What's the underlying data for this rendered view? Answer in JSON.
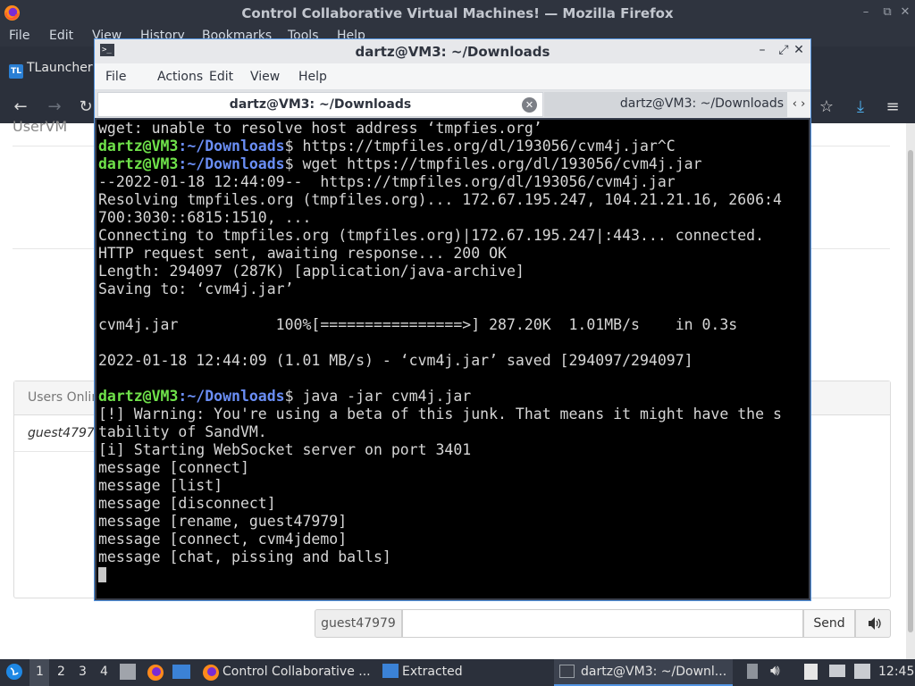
{
  "firefox": {
    "window_title": "Control Collaborative Virtual Machines! — Mozilla Firefox",
    "menu": [
      "File",
      "Edit",
      "View",
      "History",
      "Bookmarks",
      "Tools",
      "Help"
    ],
    "bookmark": "TLauncher",
    "bookmark_icon": "TL",
    "page": {
      "heading": "UserVM",
      "users_header": "Users Online",
      "users": [
        "guest47979"
      ],
      "chat_username": "guest47979",
      "send_label": "Send"
    }
  },
  "terminal": {
    "title": "dartz@VM3: ~/Downloads",
    "menu": [
      "File",
      "Actions",
      "Edit",
      "View",
      "Help"
    ],
    "tabs": [
      "dartz@VM3: ~/Downloads",
      "dartz@VM3: ~/Downloads"
    ],
    "prompt": {
      "user": "dartz@VM3",
      "path": ":~/Downloads",
      "symbol": "$"
    },
    "lines": [
      {
        "text": "wget: unable to resolve host address ‘tmpfies.org’"
      },
      {
        "prompt": true,
        "text": " https://tmpfiles.org/dl/193056/cvm4j.jar^C"
      },
      {
        "prompt": true,
        "text": " wget https://tmpfiles.org/dl/193056/cvm4j.jar"
      },
      {
        "text": "--2022-01-18 12:44:09--  https://tmpfiles.org/dl/193056/cvm4j.jar"
      },
      {
        "text": "Resolving tmpfiles.org (tmpfiles.org)... 172.67.195.247, 104.21.21.16, 2606:4"
      },
      {
        "text": "700:3030::6815:1510, ..."
      },
      {
        "text": "Connecting to tmpfiles.org (tmpfiles.org)|172.67.195.247|:443... connected."
      },
      {
        "text": "HTTP request sent, awaiting response... 200 OK"
      },
      {
        "text": "Length: 294097 (287K) [application/java-archive]"
      },
      {
        "text": "Saving to: ‘cvm4j.jar’"
      },
      {
        "text": ""
      },
      {
        "text": "cvm4j.jar           100%[================>] 287.20K  1.01MB/s    in 0.3s"
      },
      {
        "text": ""
      },
      {
        "text": "2022-01-18 12:44:09 (1.01 MB/s) - ‘cvm4j.jar’ saved [294097/294097]"
      },
      {
        "text": ""
      },
      {
        "prompt": true,
        "text": " java -jar cvm4j.jar"
      },
      {
        "text": "[!] Warning: You're using a beta of this junk. That means it might have the s"
      },
      {
        "text": "tability of SandVM."
      },
      {
        "text": "[i] Starting WebSocket server on port 3401"
      },
      {
        "text": "message [connect]"
      },
      {
        "text": "message [list]"
      },
      {
        "text": "message [disconnect]"
      },
      {
        "text": "message [rename, guest47979]"
      },
      {
        "text": "message [connect, cvm4jdemo]"
      },
      {
        "text": "message [chat, pissing and balls]"
      }
    ]
  },
  "taskbar": {
    "workspaces": [
      "1",
      "2",
      "3",
      "4"
    ],
    "tasks": [
      "Control Collaborative ...",
      "Extracted",
      "dartz@VM3: ~/Downl..."
    ],
    "clock": "12:45"
  },
  "colors": {
    "titlebar": "#2f343f",
    "accent": "#5294e2",
    "prompt_user": "#6fe24a",
    "prompt_path": "#6a8ef5"
  }
}
